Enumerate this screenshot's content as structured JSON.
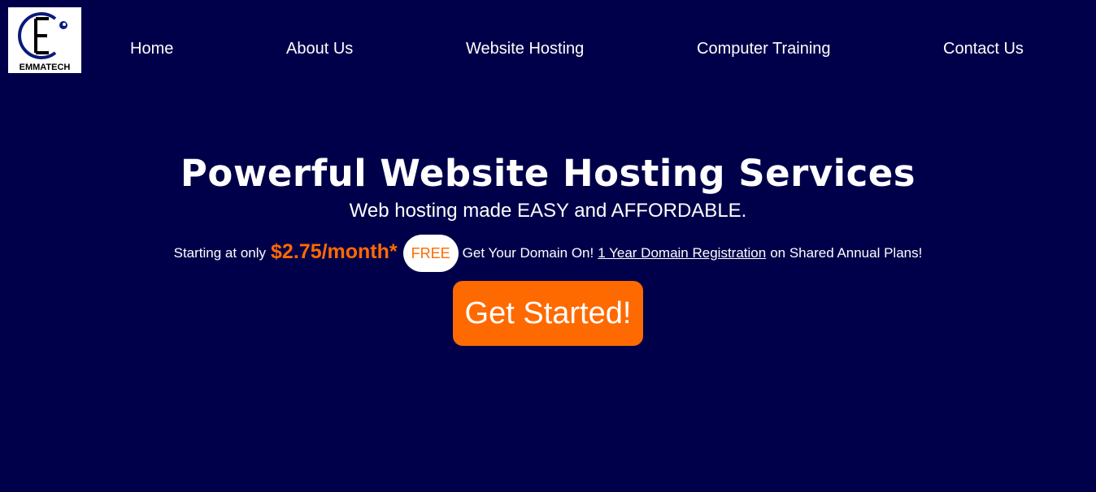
{
  "logo": {
    "text": "EMMATECH",
    "icon": "emmatech-logo-icon"
  },
  "nav": {
    "items": [
      {
        "label": "Home"
      },
      {
        "label": "About Us"
      },
      {
        "label": "Website Hosting"
      },
      {
        "label": "Computer Training"
      },
      {
        "label": "Contact Us"
      }
    ]
  },
  "hero": {
    "title": "Powerful Website Hosting Services",
    "subtitle": "Web hosting made EASY and AFFORDABLE.",
    "starting_text": "Starting at only",
    "price": "$2.75/month*",
    "free_badge": "FREE",
    "domain_text": "Get Your Domain On!",
    "domain_link": "1 Year Domain Registration",
    "plans_text": "on Shared Annual Plans!",
    "cta_label": "Get Started!"
  },
  "colors": {
    "background": "#00004a",
    "accent": "#ff6a00",
    "text": "#ffffff"
  }
}
